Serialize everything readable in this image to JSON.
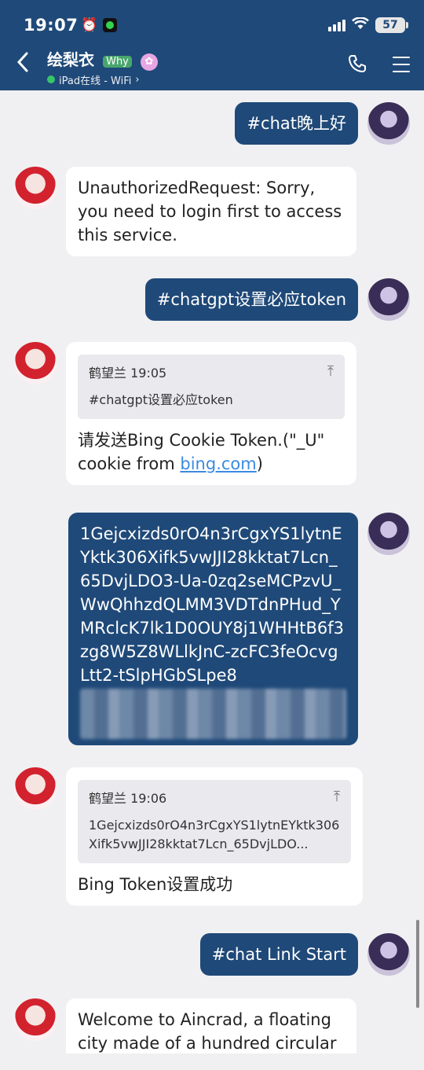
{
  "status_bar": {
    "time": "19:07",
    "battery": "57"
  },
  "header": {
    "title": "绘梨衣",
    "badge": "Why",
    "online_text": "iPad在线 - WiFi"
  },
  "messages": [
    {
      "dir": "out",
      "text": "#chat晚上好"
    },
    {
      "dir": "in",
      "text": "UnauthorizedRequest: Sorry, you need to login first to access this service."
    },
    {
      "dir": "out",
      "text": "#chatgpt设置必应token"
    },
    {
      "dir": "in",
      "quote": {
        "author_time": "鹤望兰 19:05",
        "text": "#chatgpt设置必应token"
      },
      "text": "请发送Bing Cookie Token.(\"_U\" cookie from ",
      "link": "bing.com",
      "text_after": ")"
    },
    {
      "dir": "out",
      "text": "1Gejcxizds0rO4n3rCgxYS1lytnEYktk306Xifk5vwJJI28kktat7Lcn_65DvjLDO3-Ua-0zq2seMCPzvU_WwQhhzdQLMM3VDTdnPHud_YMRclcK7lk1D0OUY8j1WHHtB6f3zg8W5Z8WLlkJnC-zcFC3feOcvgLtt2-tSlpHGbSLpe8"
    },
    {
      "dir": "in",
      "quote": {
        "author_time": "鹤望兰 19:06",
        "text": "1Gejcxizds0rO4n3rCgxYS1lytnEYktk306Xifk5vwJJI28kktat7Lcn_65DvjLDO..."
      },
      "text": "Bing Token设置成功"
    },
    {
      "dir": "out",
      "text": "#chat Link Start"
    },
    {
      "dir": "in",
      "text": "Welcome to Aincrad, a floating city made of a hundred circular"
    }
  ],
  "colors": {
    "header_bg": "#1f4978",
    "out_bubble": "#1f4978",
    "in_bubble": "#ffffff",
    "chat_bg": "#f0f0f2"
  }
}
